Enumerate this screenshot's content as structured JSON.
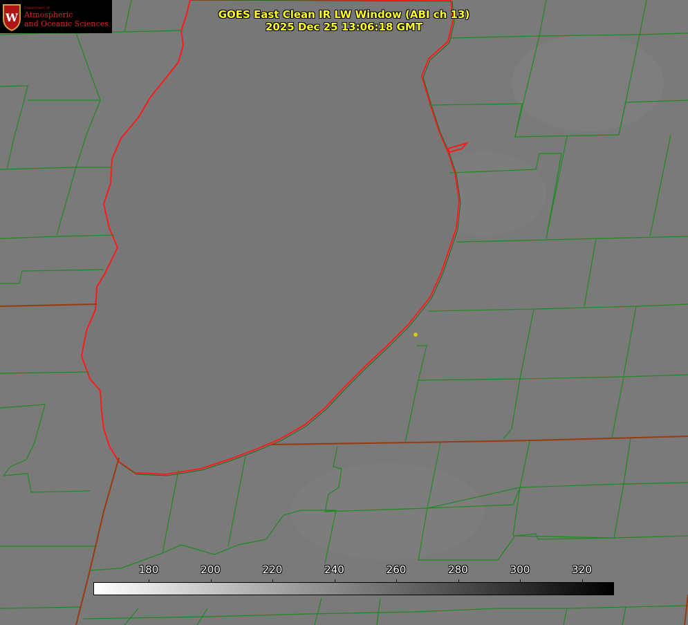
{
  "header": {
    "title_line1": "GOES East Clean IR LW Window (ABI ch 13)",
    "title_line2": "2025 Dec 25 13:06:18 GMT"
  },
  "logo": {
    "department": "Department of",
    "line1": "Atmospheric",
    "line2": "and Oceanic Sciences",
    "seal_letter": "W"
  },
  "colorbar": {
    "ticks": [
      "180",
      "200",
      "220",
      "240",
      "260",
      "280",
      "300",
      "320"
    ],
    "gradient": [
      "#ffffff",
      "#000000"
    ]
  },
  "colors": {
    "land_background": "#7a7a7a",
    "county_lines": "#1f8a1f",
    "state_lines": "#9a3a10",
    "coastline": "#ff1a1a",
    "title": "#ffff22",
    "marker": "#d8c81a"
  }
}
